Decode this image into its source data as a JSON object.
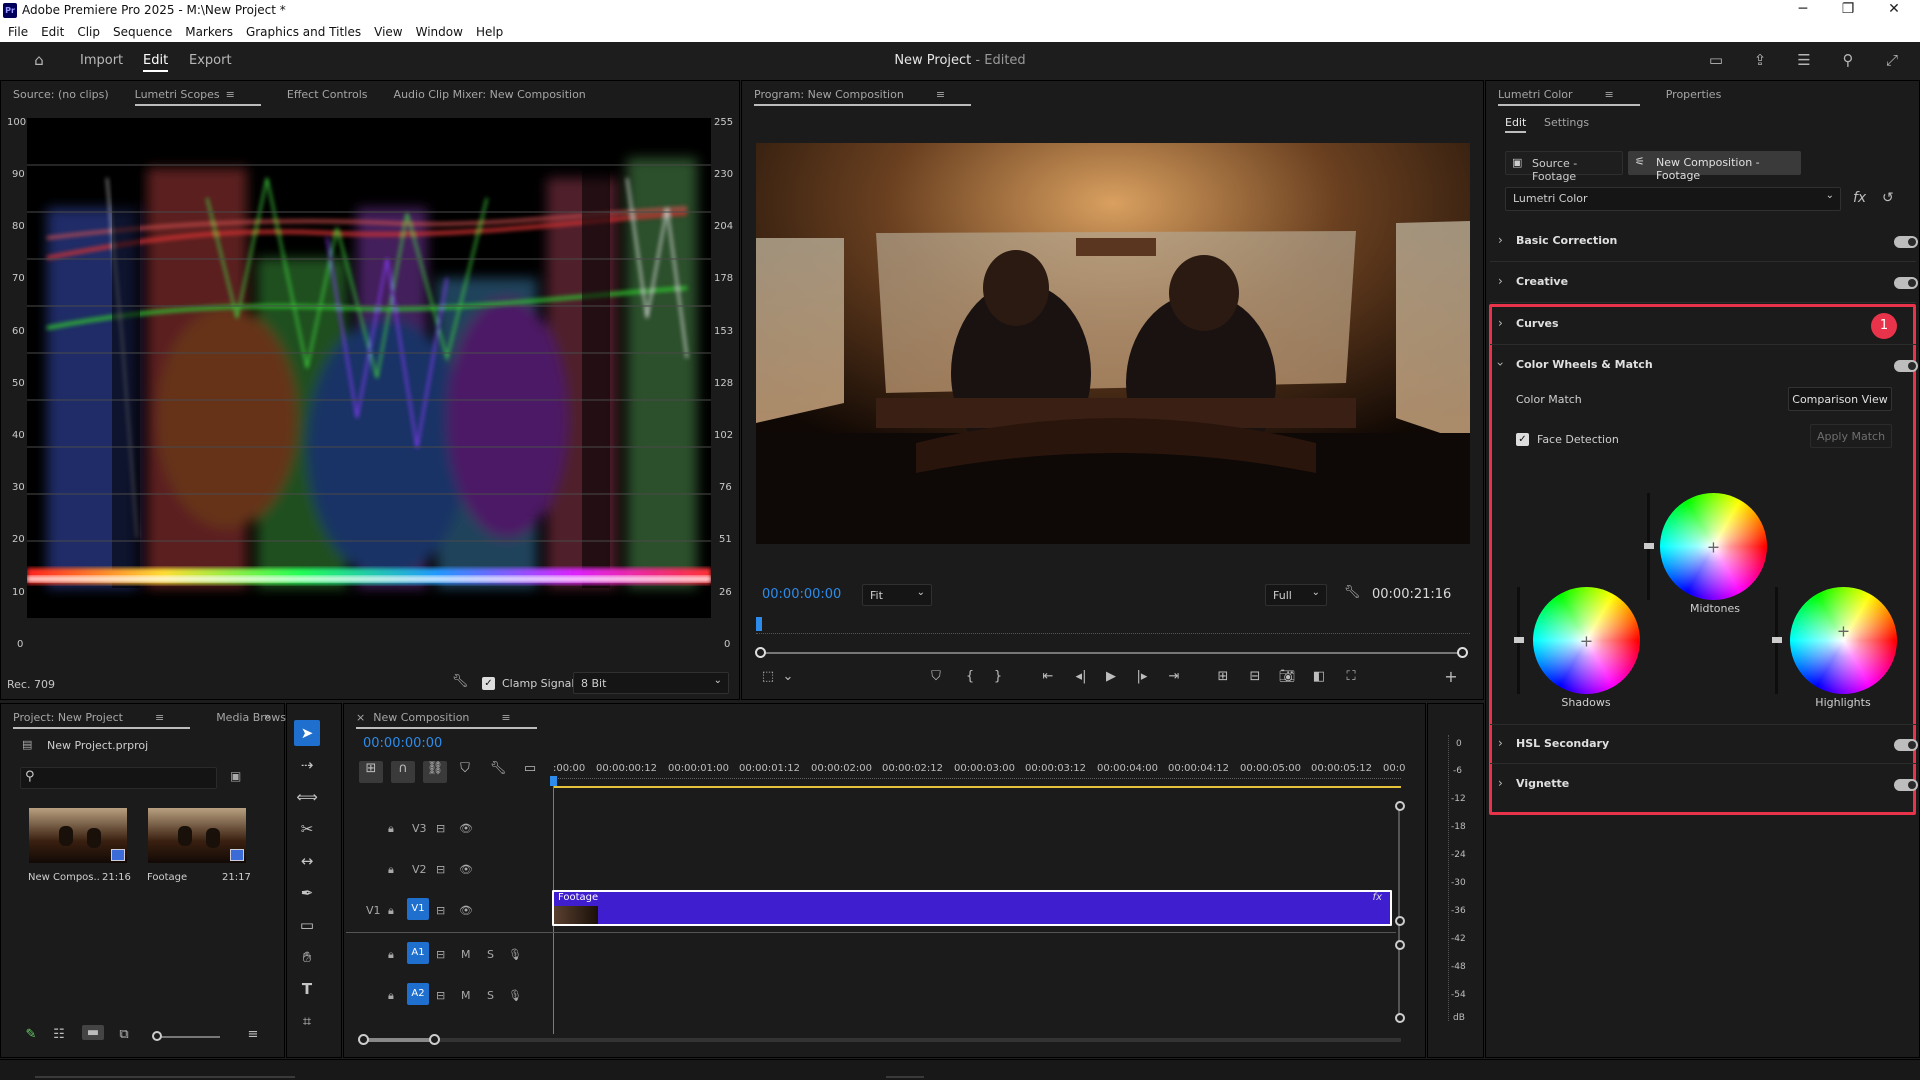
{
  "window": {
    "title": "Adobe Premiere Pro 2025 - M:\\New Project *",
    "app_badge": "Pr"
  },
  "menu": [
    "File",
    "Edit",
    "Clip",
    "Sequence",
    "Markers",
    "Graphics and Titles",
    "View",
    "Window",
    "Help"
  ],
  "header": {
    "tabs": [
      "Import",
      "Edit",
      "Export"
    ],
    "active_tab": "Edit",
    "project_title": "New Project",
    "edited_suffix": " - Edited"
  },
  "source_panel": {
    "tabs": [
      "Source: (no clips)",
      "Lumetri Scopes",
      "Effect Controls",
      "Audio Clip Mixer: New Composition"
    ],
    "active_tab": "Lumetri Scopes",
    "scale_left": [
      "100",
      "90",
      "80",
      "70",
      "60",
      "50",
      "40",
      "30",
      "20",
      "10",
      "0"
    ],
    "scale_right": [
      "255",
      "230",
      "204",
      "178",
      "153",
      "128",
      "102",
      "76",
      "51",
      "26",
      "0"
    ],
    "colorspace": "Rec. 709",
    "clamp_label": "Clamp Signal",
    "clamp_checked": true,
    "bit_depth": "8 Bit"
  },
  "program_panel": {
    "title": "Program: New Composition",
    "current_time": "00:00:00:00",
    "fit": "Fit",
    "quality": "Full",
    "duration": "00:00:21:16"
  },
  "lumetri": {
    "tabs": [
      "Lumetri Color",
      "Properties"
    ],
    "subtabs": [
      "Edit",
      "Settings"
    ],
    "source_chip": "Source - Footage",
    "seq_chip": "New Composition - Footage",
    "effect_select": "Lumetri Color",
    "fx_label": "fx",
    "sections": [
      {
        "name": "Basic Correction"
      },
      {
        "name": "Creative"
      },
      {
        "name": "Curves",
        "badge": "1"
      },
      {
        "name": "Color Wheels & Match"
      },
      {
        "name": "HSL Secondary"
      },
      {
        "name": "Vignette"
      }
    ],
    "color_match_label": "Color Match",
    "comparison_view": "Comparison View",
    "face_detection": "Face Detection",
    "face_detection_checked": true,
    "apply_match": "Apply Match",
    "wheels": [
      "Midtones",
      "Shadows",
      "Highlights"
    ],
    "highlight_color": "#e8334a"
  },
  "project_panel": {
    "tabs": [
      "Project: New Project",
      "Media Browser"
    ],
    "file": "New Project.prproj",
    "items": [
      {
        "name": "New Compos..",
        "duration": "21:16"
      },
      {
        "name": "Footage",
        "duration": "21:17"
      }
    ]
  },
  "timeline": {
    "tab": "New Composition",
    "current_time": "00:00:00:00",
    "ruler": [
      ":00:00",
      "00:00:00:12",
      "00:00:01:00",
      "00:00:01:12",
      "00:00:02:00",
      "00:00:02:12",
      "00:00:03:00",
      "00:00:03:12",
      "00:00:04:00",
      "00:00:04:12",
      "00:00:05:00",
      "00:00:05:12",
      "00:0"
    ],
    "tracks": {
      "v3": "V3",
      "v2": "V2",
      "v1": "V1",
      "v1_src": "V1",
      "a1": "A1",
      "a2": "A2",
      "m": "M",
      "s": "S"
    },
    "clip_name": "Footage",
    "clip_fx": "fx",
    "clip_color": "#3f1ecf"
  },
  "audio_meter": {
    "scale": [
      "0",
      "-6",
      "-12",
      "-18",
      "-24",
      "-30",
      "-36",
      "-42",
      "-48",
      "-54",
      "dB"
    ]
  }
}
